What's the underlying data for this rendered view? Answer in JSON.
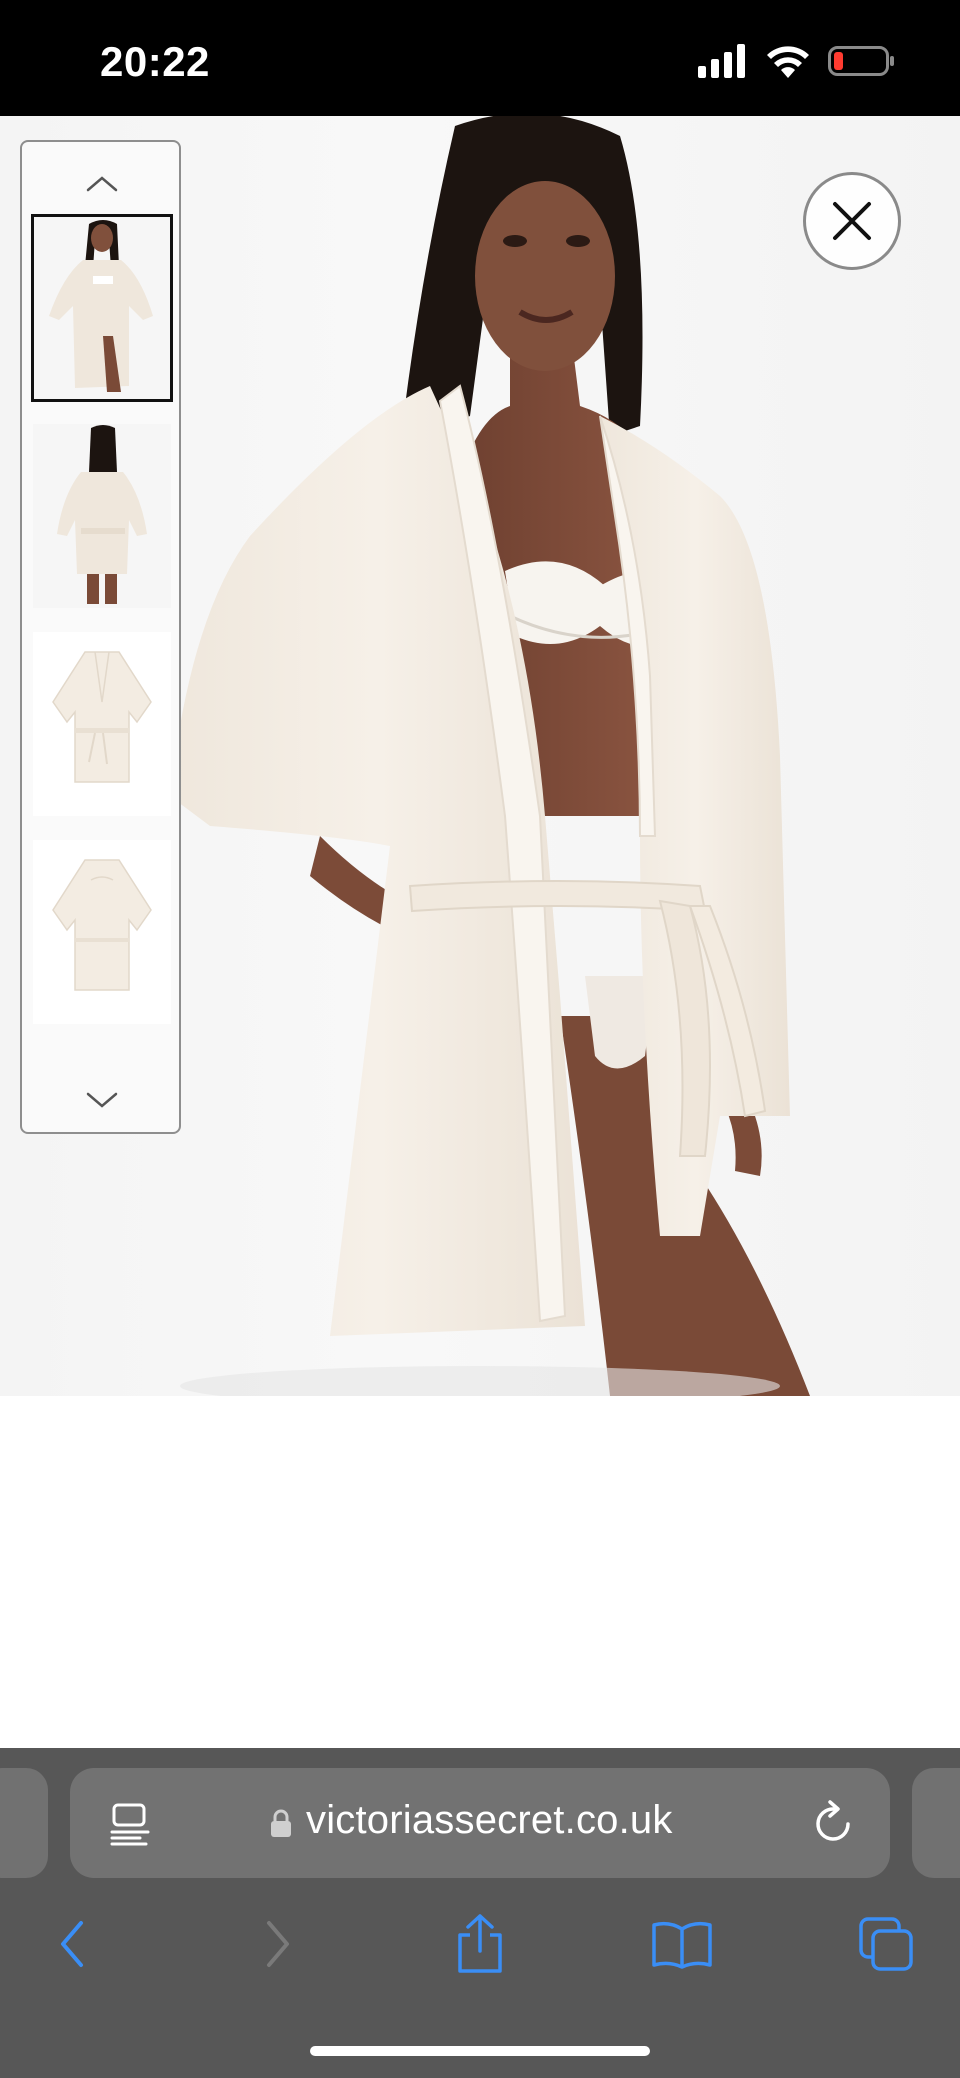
{
  "status_bar": {
    "time": "20:22",
    "icons": [
      "signal-icon",
      "wifi-icon",
      "battery-low-icon"
    ]
  },
  "viewer": {
    "close_icon": "close-icon",
    "thumbnails": [
      {
        "name": "model-front",
        "selected": true
      },
      {
        "name": "model-back",
        "selected": false
      },
      {
        "name": "robe-front-flat",
        "selected": false
      },
      {
        "name": "robe-back-flat",
        "selected": false
      }
    ],
    "arrows": [
      "chevron-up-icon",
      "chevron-down-icon"
    ]
  },
  "browser": {
    "url": "victoriassecret.co.uk",
    "toolbar": [
      "back-icon",
      "forward-icon",
      "share-icon",
      "bookmarks-icon",
      "tabs-icon"
    ]
  },
  "colors": {
    "accent": "#3a8ef6",
    "browser_chrome": "#575757",
    "robe": "#f3ece2"
  }
}
